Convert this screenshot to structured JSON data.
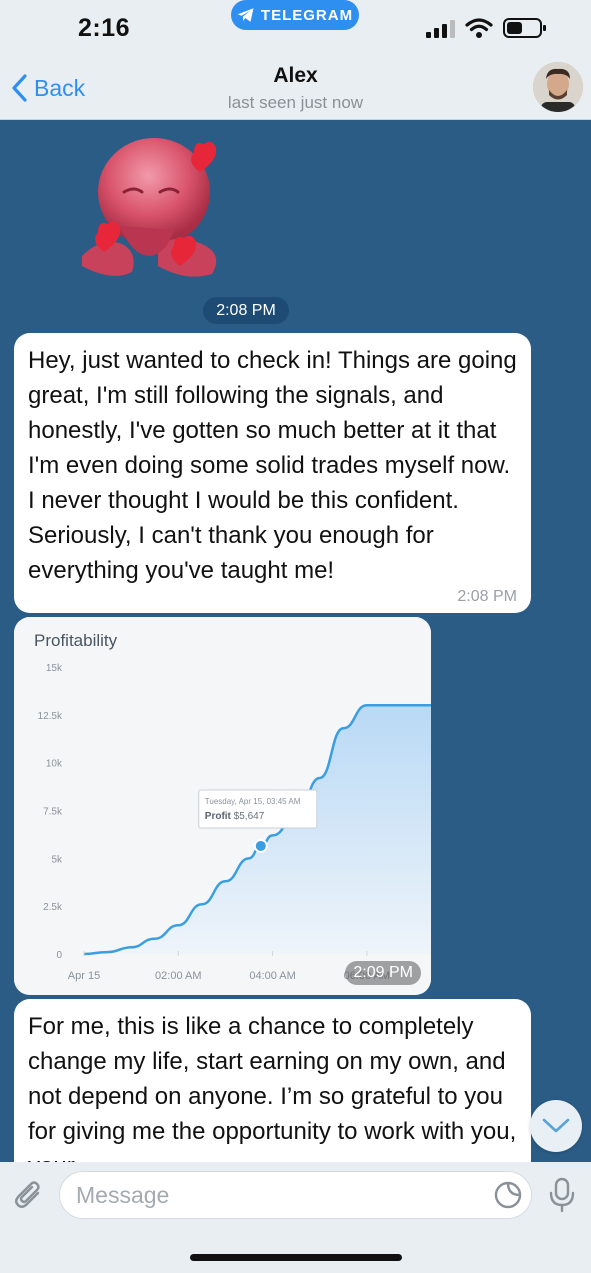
{
  "status_bar": {
    "time": "2:16",
    "app_pill": "TELEGRAM"
  },
  "header": {
    "back_label": "Back",
    "name": "Alex",
    "status": "last seen just now"
  },
  "chat": {
    "date_pill": "2:08 PM",
    "messages": [
      {
        "text": "Hey, just wanted to check in! Things are going great, I'm still following the signals, and honestly, I've gotten so much better at it that I'm even doing some solid trades myself now. I never thought I would be this confident. Seriously, I can't thank you enough for everything you've taught me!",
        "time": "2:08 PM"
      },
      {
        "image_time": "2:09 PM"
      },
      {
        "text": "For me, this is like a chance to completely change my life, start earning on my own, and not depend on anyone. I’m so grateful to you for giving me the opportunity to work with you, your"
      }
    ]
  },
  "chart_data": {
    "type": "area",
    "title": "Profitability",
    "y_ticks": [
      "0",
      "2.5k",
      "5k",
      "7.5k",
      "10k",
      "12.5k",
      "15k"
    ],
    "x_ticks": [
      "Apr 15",
      "02:00 AM",
      "04:00 AM",
      "06:00 AM"
    ],
    "ylim": [
      0,
      15000
    ],
    "x_hours": [
      0,
      0.5,
      1.0,
      1.5,
      2.0,
      2.5,
      3.0,
      3.5,
      3.75,
      4.0,
      4.5,
      5.0,
      5.5,
      6.0,
      6.5,
      7.0,
      8.0,
      9.0
    ],
    "y": [
      0,
      100,
      350,
      800,
      1500,
      2600,
      3800,
      5000,
      5647,
      6200,
      7200,
      9200,
      11800,
      13000,
      13000,
      13000,
      13000,
      13000
    ],
    "tooltip": {
      "x_hours": 3.75,
      "line1": "Tuesday, Apr 15, 03:45 AM",
      "label": "Profit",
      "value": "$5,647"
    },
    "color": "#3a9ee0"
  },
  "input": {
    "placeholder": "Message"
  }
}
